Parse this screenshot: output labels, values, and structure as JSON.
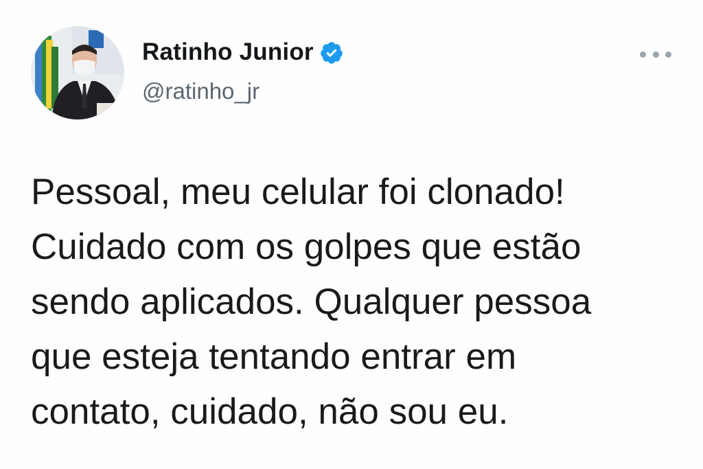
{
  "tweet": {
    "author": {
      "display_name": "Ratinho Junior",
      "handle": "@ratinho_jr",
      "verified": true,
      "avatar_icon": "profile-photo"
    },
    "menu_icon": "more-options-icon",
    "text_lines": [
      "Pessoal, meu celular foi clonado!",
      "Cuidado com os golpes que estão",
      "sendo aplicados. Qualquer pessoa",
      "que esteja tentando entrar em",
      "contato, cuidado, não sou eu."
    ]
  },
  "colors": {
    "verified_blue": "#1d9bf0",
    "name_text": "#14171a",
    "handle_text": "#5b6670",
    "body_text": "#1a1a1a"
  }
}
